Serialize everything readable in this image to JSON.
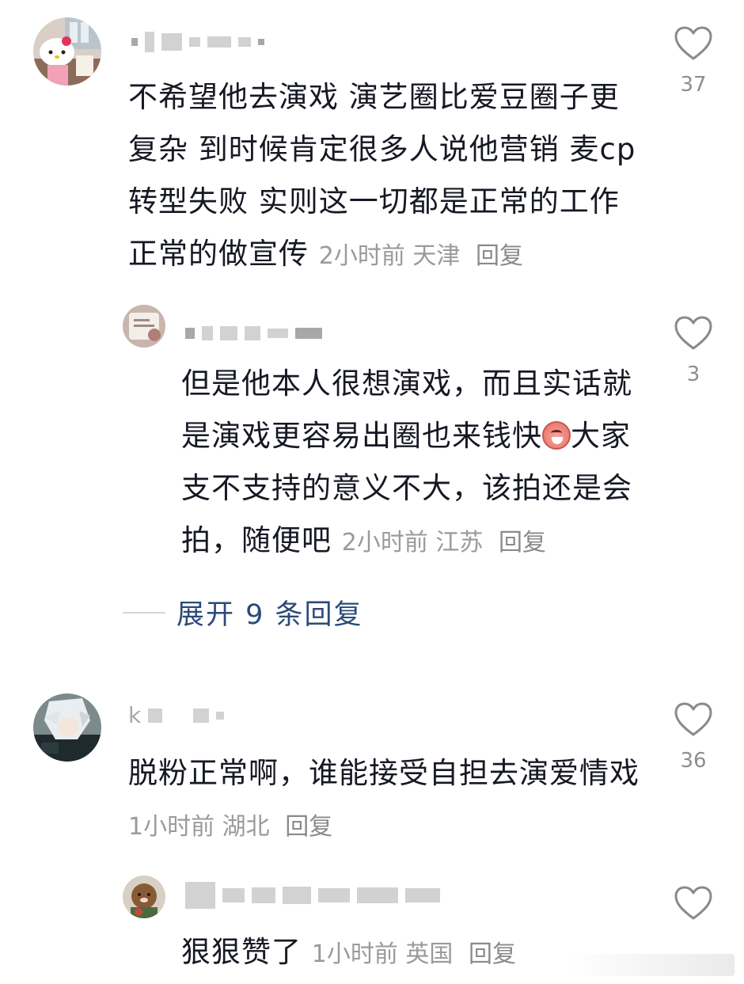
{
  "comments": [
    {
      "username": "",
      "text": "不希望他去演戏 演艺圈比爱豆圈子更复杂 到时候肯定很多人说他营销 麦cp转型失败 实则这一切都是正常的工作正常的做宣传",
      "time": "2小时前",
      "location": "天津",
      "reply_label": "回复",
      "likes": "37",
      "replies": [
        {
          "username": "",
          "text_before_emoji": "但是他本人很想演戏，而且实话就是演戏更容易出圈也来钱快",
          "emoji": "crying-face-emoji",
          "text_after_emoji": "大家支不支持的意义不大，该拍还是会拍，随便吧",
          "time": "2小时前",
          "location": "江苏",
          "reply_label": "回复",
          "likes": "3"
        }
      ],
      "expand_label": "展开 9 条回复"
    },
    {
      "username": "k",
      "text": "脱粉正常啊，谁能接受自担去演爱情戏",
      "time": "1小时前",
      "location": "湖北",
      "reply_label": "回复",
      "likes": "36",
      "replies": [
        {
          "username": "",
          "text": "狠狠赞了",
          "time": "1小时前",
          "location": "英国",
          "reply_label": "回复",
          "likes": ""
        }
      ]
    }
  ],
  "colors": {
    "text": "#161823",
    "meta": "#9a9a9a",
    "expand": "#2b4a78",
    "icon": "#8a8a8a"
  }
}
